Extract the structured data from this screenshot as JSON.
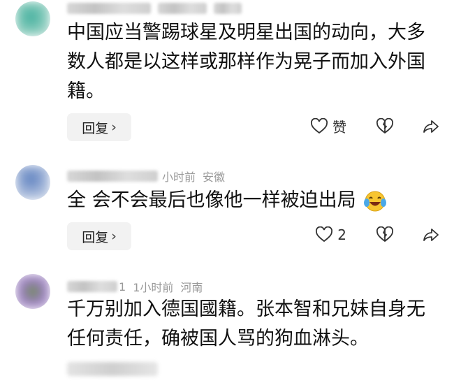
{
  "comments": [
    {
      "text": "中国应当警踢球星及明星出国的动向，大多数人都是以这样或那样作为晃子而加入外国籍。",
      "reply_label": "回复",
      "like_label": "赞",
      "like_count": "",
      "avatar_color": "#3fae9d"
    },
    {
      "time": "小时前",
      "location": "安徽",
      "text": "全 会不会最后也像他一样被迫出局",
      "reply_label": "回复",
      "like_label": "",
      "like_count": "2",
      "avatar_color": "#5b7fbf"
    },
    {
      "name_tail": "1",
      "time": "1小时前",
      "location": "河南",
      "text": "千万别加入德国國籍。张本智和兄妹自身无任何责任，确被国人骂的狗血淋头。",
      "avatar_color": "#6f8f52"
    }
  ]
}
